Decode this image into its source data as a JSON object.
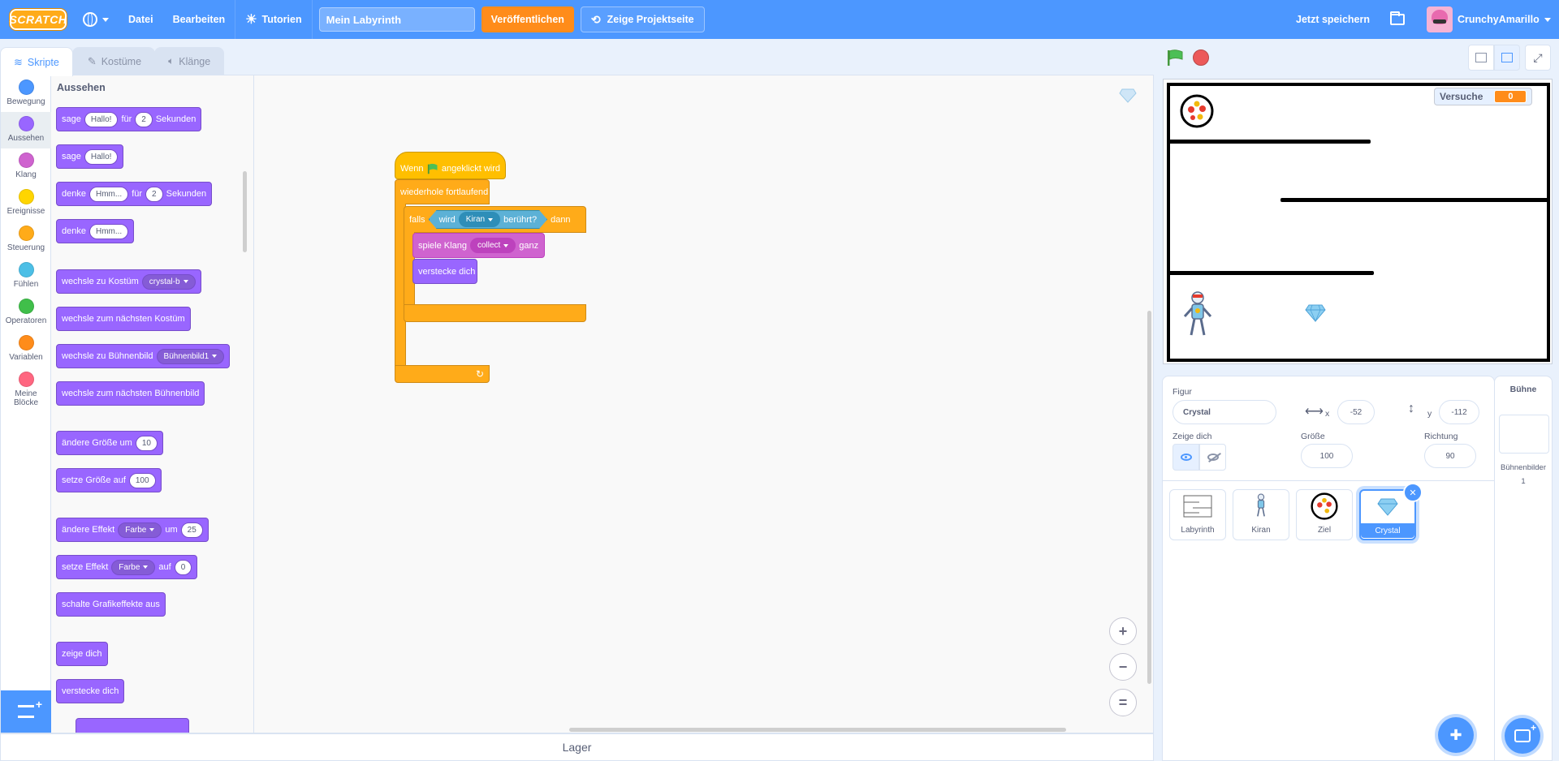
{
  "menubar": {
    "logo": "SCRATCH",
    "file": "Datei",
    "edit": "Bearbeiten",
    "tutorials": "Tutorien",
    "project_title": "Mein Labyrinth",
    "publish": "Veröffentlichen",
    "project_page": "Zeige Projektseite",
    "save_now": "Jetzt speichern",
    "username": "CrunchyAmarillo"
  },
  "tabs": {
    "code": "Skripte",
    "costumes": "Kostüme",
    "sounds": "Klänge"
  },
  "categories": [
    {
      "label": "Bewegung",
      "color": "#4c97ff"
    },
    {
      "label": "Aussehen",
      "color": "#9966ff"
    },
    {
      "label": "Klang",
      "color": "#cf63cf"
    },
    {
      "label": "Ereignisse",
      "color": "#ffd500"
    },
    {
      "label": "Steuerung",
      "color": "#ffab19"
    },
    {
      "label": "Fühlen",
      "color": "#4cbfe6"
    },
    {
      "label": "Operatoren",
      "color": "#40bf4a"
    },
    {
      "label": "Variablen",
      "color": "#ff8c1a"
    },
    {
      "label": "Meine Blöcke",
      "color": "#ff6680"
    }
  ],
  "flyout": {
    "heading": "Aussehen",
    "say_for": {
      "a": "sage",
      "msg": "Hallo!",
      "b": "für",
      "secs": "2",
      "c": "Sekunden"
    },
    "say": {
      "a": "sage",
      "msg": "Hallo!"
    },
    "think_for": {
      "a": "denke",
      "msg": "Hmm...",
      "b": "für",
      "secs": "2",
      "c": "Sekunden"
    },
    "think": {
      "a": "denke",
      "msg": "Hmm..."
    },
    "switch_costume": {
      "a": "wechsle zu Kostüm",
      "costume": "crystal-b"
    },
    "next_costume": "wechsle zum nächsten Kostüm",
    "switch_backdrop": {
      "a": "wechsle zu Bühnenbild",
      "backdrop": "Bühnenbild1"
    },
    "next_backdrop": "wechsle zum nächsten Bühnenbild",
    "change_size": {
      "a": "ändere Größe um",
      "val": "10"
    },
    "set_size": {
      "a": "setze Größe auf",
      "val": "100"
    },
    "change_effect": {
      "a": "ändere Effekt",
      "effect": "Farbe",
      "b": "um",
      "val": "25"
    },
    "set_effect": {
      "a": "setze Effekt",
      "effect": "Farbe",
      "b": "auf",
      "val": "0"
    },
    "clear_effects": "schalte Grafikeffekte aus",
    "show": "zeige dich",
    "hide": "verstecke dich"
  },
  "script": {
    "hat_a": "Wenn",
    "hat_b": "angeklickt wird",
    "forever": "wiederhole fortlaufend",
    "if_a": "falls",
    "if_b": "dann",
    "touching_a": "wird",
    "touching_target": "Kiran",
    "touching_b": "berührt?",
    "play_a": "spiele Klang",
    "sound": "collect",
    "play_b": "ganz",
    "hide": "verstecke dich"
  },
  "zoom": {
    "in": "+",
    "out": "−",
    "reset": "="
  },
  "backpack": "Lager",
  "stage": {
    "monitor_label": "Versuche",
    "monitor_value": "0"
  },
  "sprite_info": {
    "sprite_label": "Figur",
    "sprite_name": "Crystal",
    "x_label": "x",
    "x_value": "-52",
    "y_label": "y",
    "y_value": "-112",
    "show_label": "Zeige dich",
    "size_label": "Größe",
    "size_value": "100",
    "direction_label": "Richtung",
    "direction_value": "90"
  },
  "sprites": [
    {
      "name": "Labyrinth",
      "icon": "maze-icon"
    },
    {
      "name": "Kiran",
      "icon": "robot-icon"
    },
    {
      "name": "Ziel",
      "icon": "target-icon"
    },
    {
      "name": "Crystal",
      "icon": "gem-icon",
      "selected": true
    }
  ],
  "stage_pane": {
    "heading": "Bühne",
    "backdrops_label": "Bühnenbilder",
    "backdrops_count": "1"
  }
}
